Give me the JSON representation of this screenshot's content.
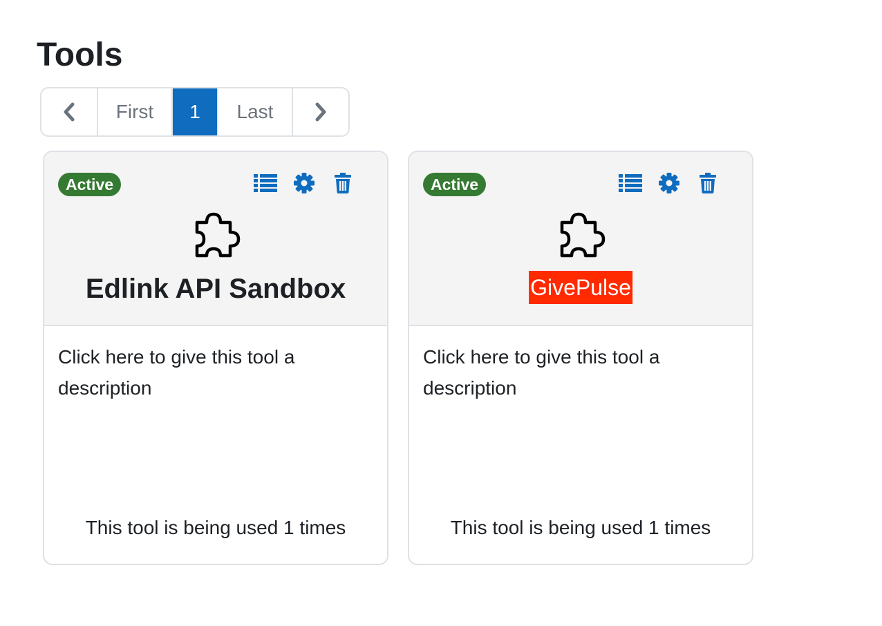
{
  "page": {
    "title": "Tools"
  },
  "pagination": {
    "prev_icon": "chevron-left-icon",
    "first_label": "First",
    "current_page": "1",
    "last_label": "Last",
    "next_icon": "chevron-right-icon"
  },
  "colors": {
    "accent": "#0f6cbf",
    "badge_active": "#357a32",
    "givepulse_logo_bg": "#ff2a00"
  },
  "tools": [
    {
      "status": "Active",
      "icons": [
        "list-icon",
        "gear-icon",
        "trash-icon",
        "puzzle-piece-icon"
      ],
      "name": "Edlink API Sandbox",
      "description": "Click here to give this tool a description",
      "usage": "This tool is being used 1 times"
    },
    {
      "status": "Active",
      "icons": [
        "list-icon",
        "gear-icon",
        "trash-icon",
        "puzzle-piece-icon"
      ],
      "name": "GivePulse",
      "description": "Click here to give this tool a description",
      "usage": "This tool is being used 1 times"
    }
  ]
}
